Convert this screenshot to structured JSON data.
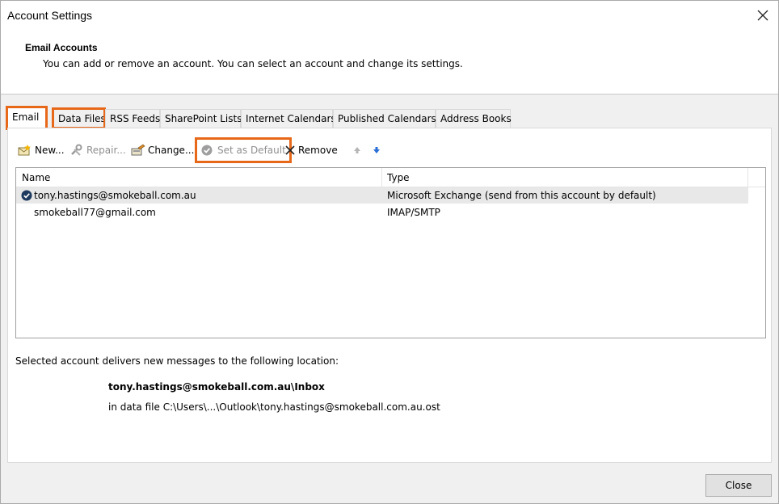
{
  "window": {
    "title": "Account Settings",
    "close_icon": "close-icon"
  },
  "header": {
    "title": "Email Accounts",
    "description": "You can add or remove an account. You can select an account and change its settings."
  },
  "tabs": [
    {
      "label": "Email",
      "active": true,
      "highlighted": true
    },
    {
      "label": "Data Files",
      "active": false,
      "highlighted": true
    },
    {
      "label": "RSS Feeds",
      "active": false,
      "highlighted": false
    },
    {
      "label": "SharePoint Lists",
      "active": false,
      "highlighted": false
    },
    {
      "label": "Internet Calendars",
      "active": false,
      "highlighted": false
    },
    {
      "label": "Published Calendars",
      "active": false,
      "highlighted": false
    },
    {
      "label": "Address Books",
      "active": false,
      "highlighted": false
    }
  ],
  "toolbar": {
    "new_label": "New...",
    "repair_label": "Repair...",
    "change_label": "Change...",
    "set_default_label": "Set as Default",
    "remove_label": "Remove"
  },
  "list": {
    "columns": [
      "Name",
      "Type"
    ],
    "rows": [
      {
        "name": "tony.hastings@smokeball.com.au",
        "type": "Microsoft Exchange (send from this account by default)",
        "default": true
      },
      {
        "name": "smokeball77@gmail.com",
        "type": "IMAP/SMTP",
        "default": false
      }
    ]
  },
  "delivery": {
    "label": "Selected account delivers new messages to the following location:",
    "target": "tony.hastings@smokeball.com.au\\Inbox",
    "file": "in data file C:\\Users\\...\\Outlook\\tony.hastings@smokeball.com.au.ost"
  },
  "footer": {
    "close_label": "Close"
  },
  "colors": {
    "highlight": "#e8681a",
    "default_check": "#1f3a5f",
    "arrow_blue": "#2b6fd6"
  }
}
